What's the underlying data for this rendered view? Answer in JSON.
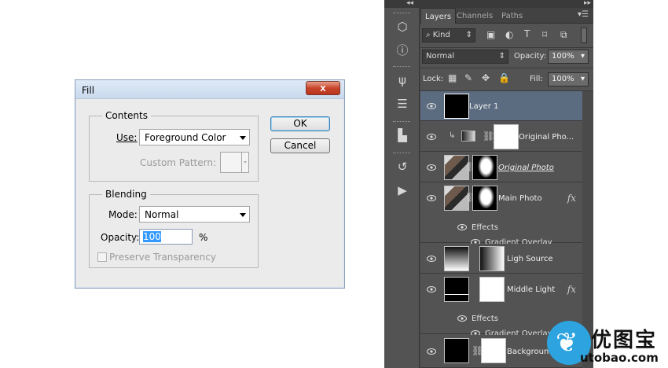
{
  "dialog": {
    "title": "Fill",
    "close_label": "x",
    "contents": {
      "legend": "Contents",
      "use_label": "Use:",
      "use_value": "Foreground Color",
      "custom_pattern_label": "Custom Pattern:"
    },
    "blending": {
      "legend": "Blending",
      "mode_label": "Mode:",
      "mode_value": "Normal",
      "opacity_label": "Opacity:",
      "opacity_value": "100",
      "opacity_unit": "%",
      "preserve_label": "Preserve Transparency",
      "preserve_checked": false
    },
    "ok_label": "OK",
    "cancel_label": "Cancel"
  },
  "layers_panel": {
    "tabs": [
      {
        "label": "Layers",
        "active": true
      },
      {
        "label": "Channels",
        "active": false
      },
      {
        "label": "Paths",
        "active": false
      }
    ],
    "filter_label": "Kind",
    "blend_mode": "Normal",
    "opacity_label": "Opacity:",
    "opacity_value": "100%",
    "lock_label": "Lock:",
    "fill_label": "Fill:",
    "fill_value": "100%",
    "layers": [
      {
        "name": "Layer 1",
        "selected": true
      },
      {
        "name": "Original Pho...",
        "selected": false
      },
      {
        "name": "Original Photo",
        "selected": false
      },
      {
        "name": "Main Photo",
        "selected": false,
        "effects_label": "Effects",
        "effect": "Gradient Overlay"
      },
      {
        "name": "Ligh Source",
        "selected": false
      },
      {
        "name": "Middle Light",
        "selected": false,
        "effects_label": "Effects",
        "effect": "Gradient Overlay"
      },
      {
        "name": "Background Co...",
        "selected": false
      }
    ],
    "fx_label": "fx"
  },
  "watermark": {
    "cn_text": "优图宝",
    "url_text": "utobao.com"
  }
}
